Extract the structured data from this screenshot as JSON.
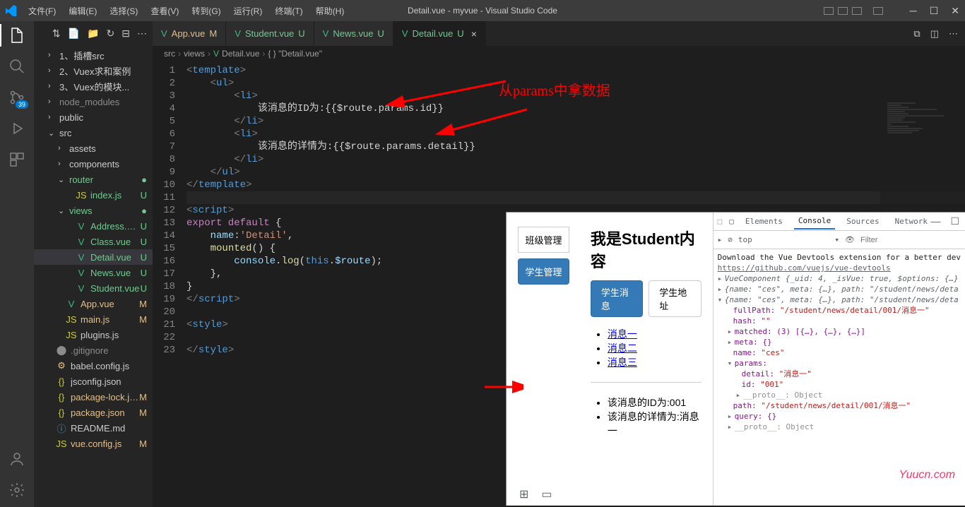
{
  "window": {
    "title": "Detail.vue - myvue - Visual Studio Code"
  },
  "menu": [
    "文件(F)",
    "编辑(E)",
    "选择(S)",
    "查看(V)",
    "转到(G)",
    "运行(R)",
    "终端(T)",
    "帮助(H)"
  ],
  "activity_badge": "39",
  "sidebar": {
    "items": [
      {
        "indent": 1,
        "chev": "›",
        "name": "1、插槽src",
        "cls": "c-normal"
      },
      {
        "indent": 1,
        "chev": "›",
        "name": "2、Vuex求和案例",
        "cls": "c-normal"
      },
      {
        "indent": 1,
        "chev": "›",
        "name": "3、Vuex的模块...",
        "cls": "c-normal"
      },
      {
        "indent": 1,
        "chev": "›",
        "name": "node_modules",
        "cls": "c-dim"
      },
      {
        "indent": 1,
        "chev": "›",
        "name": "public",
        "cls": "c-normal"
      },
      {
        "indent": 1,
        "chev": "⌄",
        "name": "src",
        "cls": "c-normal",
        "open": true
      },
      {
        "indent": 2,
        "chev": "›",
        "name": "assets",
        "cls": "c-normal"
      },
      {
        "indent": 2,
        "chev": "›",
        "name": "components",
        "cls": "c-normal"
      },
      {
        "indent": 2,
        "chev": "⌄",
        "name": "router",
        "cls": "c-untracked",
        "status": "●",
        "open": true
      },
      {
        "indent": 3,
        "icon": "JS",
        "iconcls": "ic-js",
        "name": "index.js",
        "cls": "c-untracked",
        "status": "U"
      },
      {
        "indent": 2,
        "chev": "⌄",
        "name": "views",
        "cls": "c-untracked",
        "status": "●",
        "open": true
      },
      {
        "indent": 3,
        "icon": "V",
        "iconcls": "ic-vue",
        "name": "Address.vue",
        "cls": "c-untracked",
        "status": "U"
      },
      {
        "indent": 3,
        "icon": "V",
        "iconcls": "ic-vue",
        "name": "Class.vue",
        "cls": "c-untracked",
        "status": "U"
      },
      {
        "indent": 3,
        "icon": "V",
        "iconcls": "ic-vue",
        "name": "Detail.vue",
        "cls": "c-untracked",
        "status": "U",
        "selected": true
      },
      {
        "indent": 3,
        "icon": "V",
        "iconcls": "ic-vue",
        "name": "News.vue",
        "cls": "c-untracked",
        "status": "U"
      },
      {
        "indent": 3,
        "icon": "V",
        "iconcls": "ic-vue",
        "name": "Student.vue",
        "cls": "c-untracked",
        "status": "U"
      },
      {
        "indent": 2,
        "icon": "V",
        "iconcls": "ic-vue",
        "name": "App.vue",
        "cls": "c-modified",
        "status": "M"
      },
      {
        "indent": 2,
        "icon": "JS",
        "iconcls": "ic-js",
        "name": "main.js",
        "cls": "c-modified",
        "status": "M"
      },
      {
        "indent": 2,
        "icon": "JS",
        "iconcls": "ic-js",
        "name": "plugins.js",
        "cls": "c-normal"
      },
      {
        "indent": 1,
        "icon": "⬤",
        "iconcls": "c-dim",
        "name": ".gitignore",
        "cls": "c-dim"
      },
      {
        "indent": 1,
        "icon": "⚙",
        "iconcls": "c-modified",
        "name": "babel.config.js",
        "cls": "c-normal"
      },
      {
        "indent": 1,
        "icon": "{}",
        "iconcls": "ic-json",
        "name": "jsconfig.json",
        "cls": "c-normal"
      },
      {
        "indent": 1,
        "icon": "{}",
        "iconcls": "ic-json",
        "name": "package-lock.json",
        "cls": "c-modified",
        "status": "M"
      },
      {
        "indent": 1,
        "icon": "{}",
        "iconcls": "ic-json",
        "name": "package.json",
        "cls": "c-modified",
        "status": "M"
      },
      {
        "indent": 1,
        "icon": "ⓘ",
        "iconcls": "ic-readme",
        "name": "README.md",
        "cls": "c-normal"
      },
      {
        "indent": 1,
        "icon": "JS",
        "iconcls": "ic-js",
        "name": "vue.config.js",
        "cls": "c-modified",
        "status": "M"
      }
    ]
  },
  "tabs": [
    {
      "icon": "V",
      "name": "App.vue",
      "status": "M",
      "statuscls": "c-modified"
    },
    {
      "icon": "V",
      "name": "Student.vue",
      "status": "U",
      "statuscls": "c-untracked"
    },
    {
      "icon": "V",
      "name": "News.vue",
      "status": "U",
      "statuscls": "c-untracked"
    },
    {
      "icon": "V",
      "name": "Detail.vue",
      "status": "U",
      "statuscls": "c-untracked",
      "active": true,
      "close": true
    }
  ],
  "breadcrumb": [
    "src",
    "views",
    "Detail.vue",
    "{ } \"Detail.vue\""
  ],
  "code_lines": 23,
  "annotation_text": "从params中拿数据",
  "browser": {
    "nav": [
      "班级管理",
      "学生管理"
    ],
    "title": "我是Student内容",
    "tabs": [
      "学生消息",
      "学生地址"
    ],
    "links": [
      "消息一",
      "消息二",
      "消息三"
    ],
    "results": [
      "该消息的ID为:001",
      "该消息的详情为:消息一"
    ]
  },
  "devtools": {
    "tabs": [
      "Elements",
      "Console",
      "Sources",
      "Network"
    ],
    "active_tab": "Console",
    "top_label": "top",
    "filter_placeholder": "Filter",
    "download_msg": "Download the Vue Devtools extension for a better dev",
    "download_link": "https://github.com/vuejs/vue-devtools",
    "lines": {
      "l1": "VueComponent {_uid: 4, _isVue: true, $options: {…}",
      "l2_pre": "{name: \"ces\", meta: {…}, path: \"/student/news/deta",
      "l3_pre": "{name: \"ces\", meta: {…}, path: \"/student/news/deta",
      "fullPath_k": "fullPath:",
      "fullPath_v": "\"/student/news/detail/001/消息一\"",
      "hash_k": "hash:",
      "hash_v": "\"\"",
      "matched": "matched: (3) [{…}, {…}, {…}]",
      "meta": "meta: {}",
      "name_k": "name:",
      "name_v": "\"ces\"",
      "params": "params:",
      "detail_k": "detail:",
      "detail_v": "\"消息一\"",
      "id_k": "id:",
      "id_v": "\"001\"",
      "proto1": "__proto__: Object",
      "path_k": "path:",
      "path_v": "\"/student/news/detail/001/消息一\"",
      "query": "query: {}",
      "proto2": "__proto__: Object"
    }
  },
  "watermark": "Yuucn.com"
}
